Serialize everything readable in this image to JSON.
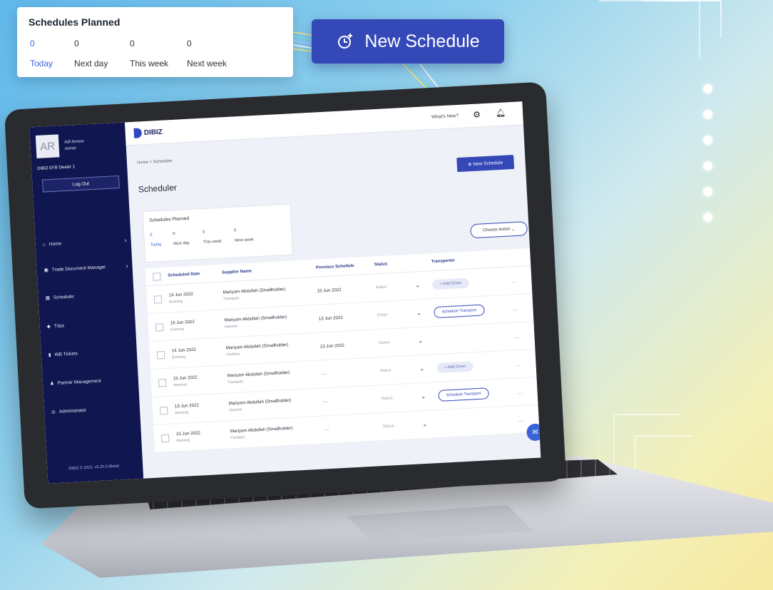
{
  "floating_card": {
    "title": "Schedules Planned",
    "stats": [
      {
        "count": "0",
        "label": "Today"
      },
      {
        "count": "0",
        "label": "Next day"
      },
      {
        "count": "0",
        "label": "This week"
      },
      {
        "count": "0",
        "label": "Next week"
      }
    ]
  },
  "floating_button": {
    "label": "New Schedule",
    "icon": "clock-plus-icon"
  },
  "sidebar": {
    "avatar_initials": "AR",
    "user_name": "Atif Ameer",
    "user_role": "owner",
    "dealer": "DIBIZ EFB Dealer 1",
    "logout_label": "Log Out",
    "items": [
      {
        "label": "Home",
        "icon": "home-icon"
      },
      {
        "label": "Trade Document Manager",
        "icon": "truck-icon"
      },
      {
        "label": "Scheduler",
        "icon": "calendar-icon"
      },
      {
        "label": "Trips",
        "icon": "car-icon"
      },
      {
        "label": "WB Tickets",
        "icon": "ticket-icon"
      },
      {
        "label": "Partner Management",
        "icon": "partners-icon"
      },
      {
        "label": "Administrator",
        "icon": "admin-icon"
      }
    ],
    "footer": "DIBIZ © 2022, v6.25.0 (Beta)"
  },
  "topbar": {
    "logo": "DIBIZ",
    "whats_new": "What's New?"
  },
  "breadcrumb": "Home > Scheduler",
  "page_title": "Scheduler",
  "new_schedule_button": "New Schedule",
  "mini_card": {
    "title": "Schedules Planned",
    "stats": [
      {
        "count": "0",
        "label": "Today"
      },
      {
        "count": "0",
        "label": "Next day"
      },
      {
        "count": "0",
        "label": "This week"
      },
      {
        "count": "0",
        "label": "Next week"
      }
    ]
  },
  "choose_action": "Choose Action",
  "table": {
    "headers": [
      "Scheduled Date",
      "Supplier Name",
      "Previous Schedule",
      "Status",
      "Transporter"
    ],
    "rows": [
      {
        "date": "14 Jun 2022",
        "period": "Evening",
        "supplier": "Mariyam Abdullah (Smallholder)",
        "type": "Transport",
        "prev": "15 Jun 2022",
        "status": "Status",
        "transporter": "Add Driver",
        "trans_type": "add"
      },
      {
        "date": "16 Jun 2022",
        "period": "Evening",
        "supplier": "Mariyam Abdullah (Smallholder)",
        "type": "Harvest",
        "prev": "13 Jun 2022",
        "status": "Driver",
        "transporter": "Schedule Transport",
        "trans_type": "sched"
      },
      {
        "date": "14 Jun 2022",
        "period": "Evening",
        "supplier": "Mariyam Abdullah (Smallholder)",
        "type": "Fertilizer",
        "prev": "13 Jun 2022",
        "status": "Owner",
        "transporter": "",
        "trans_type": "none"
      },
      {
        "date": "15 Jun 2022",
        "period": "Morning",
        "supplier": "Mariyam Abdullah (Smallholder)",
        "type": "Transport",
        "prev": "- -",
        "status": "Status",
        "transporter": "Add Driver",
        "trans_type": "add"
      },
      {
        "date": "13 Jun 2022",
        "period": "Morning",
        "supplier": "Mariyam Abdullah (Smallholder)",
        "type": "Harvest",
        "prev": "- -",
        "status": "Status",
        "transporter": "Schedule Transport",
        "trans_type": "sched"
      },
      {
        "date": "15 Jun 2022",
        "period": "Morning",
        "supplier": "Mariyam Abdullah (Smallholder)",
        "type": "Fertilizer",
        "prev": "- -",
        "status": "Status",
        "transporter": "",
        "trans_type": "none"
      }
    ]
  },
  "colors": {
    "brand": "#3448b8",
    "sidebar": "#101650",
    "accent": "#3a63d8"
  }
}
